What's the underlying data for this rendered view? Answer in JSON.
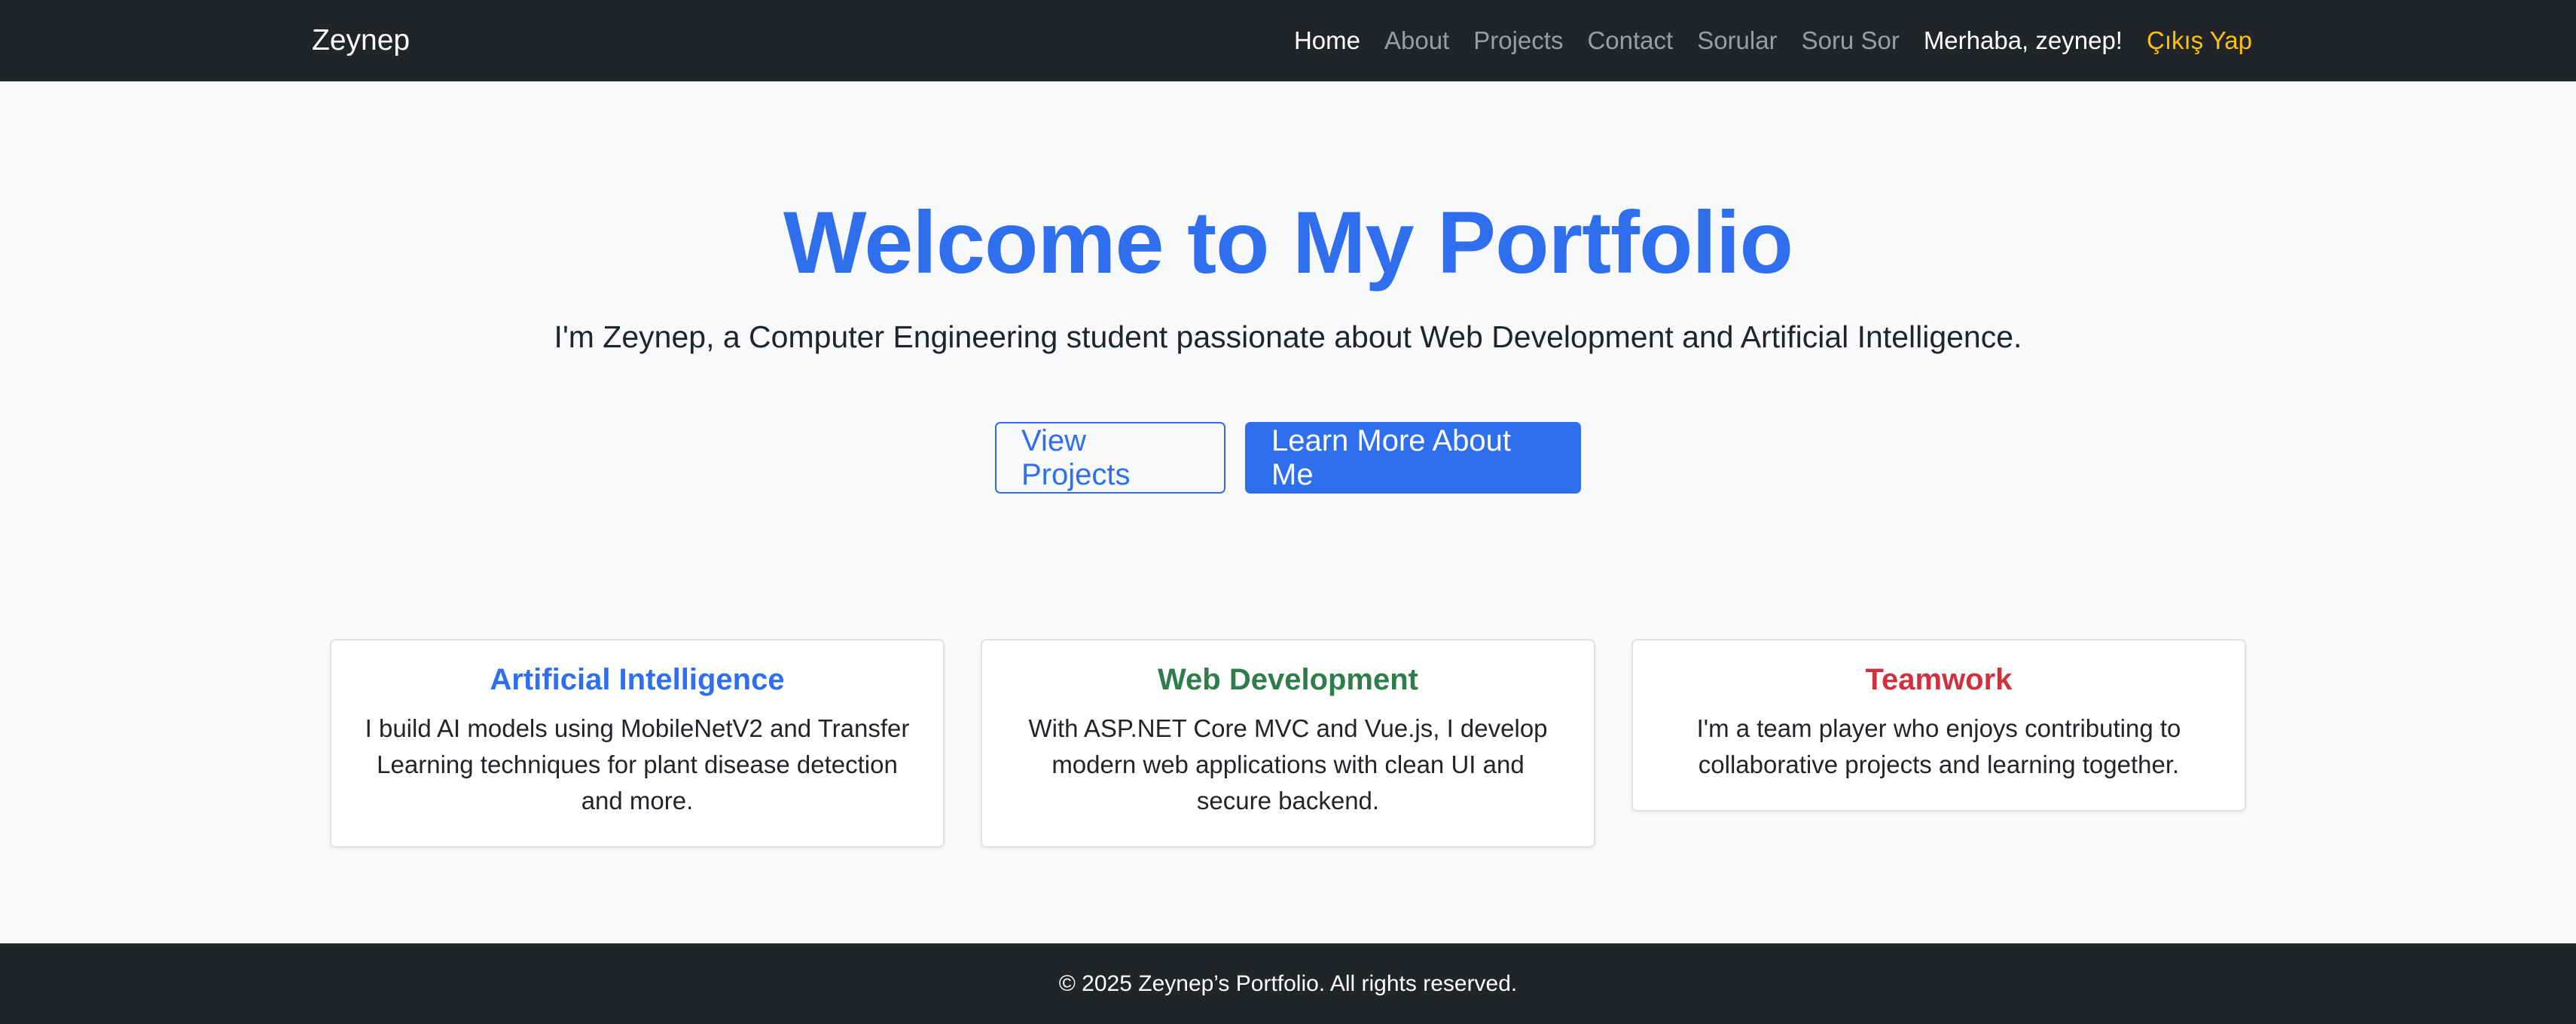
{
  "navbar": {
    "brand": "Zeynep",
    "links": [
      {
        "label": "Home",
        "active": true
      },
      {
        "label": "About"
      },
      {
        "label": "Projects"
      },
      {
        "label": "Contact"
      },
      {
        "label": "Sorular"
      },
      {
        "label": "Soru Sor"
      }
    ],
    "greeting": "Merhaba, zeynep!",
    "logout": "Çıkış Yap"
  },
  "hero": {
    "title": "Welcome to My Portfolio",
    "subtitle": "I'm Zeynep, a Computer Engineering student passionate about Web Development and Artificial Intelligence.",
    "view_projects": "View Projects",
    "learn_more": "Learn More About Me"
  },
  "cards": [
    {
      "title": "Artificial Intelligence",
      "text": "I build AI models using MobileNetV2 and Transfer Learning techniques for plant disease detection and more.",
      "color": "#2f6fed"
    },
    {
      "title": "Web Development",
      "text": "With ASP.NET Core MVC and Vue.js, I develop modern web applications with clean UI and secure backend.",
      "color": "#2e7d4a"
    },
    {
      "title": "Teamwork",
      "text": "I'm a team player who enjoys contributing to collaborative projects and learning together.",
      "color": "#d0313f"
    }
  ],
  "footer": {
    "text": "© 2025 Zeynep’s Portfolio. All rights reserved."
  },
  "colors": {
    "navbar_bg": "#212529",
    "primary": "#2f6fed",
    "logout": "#ffc107"
  }
}
